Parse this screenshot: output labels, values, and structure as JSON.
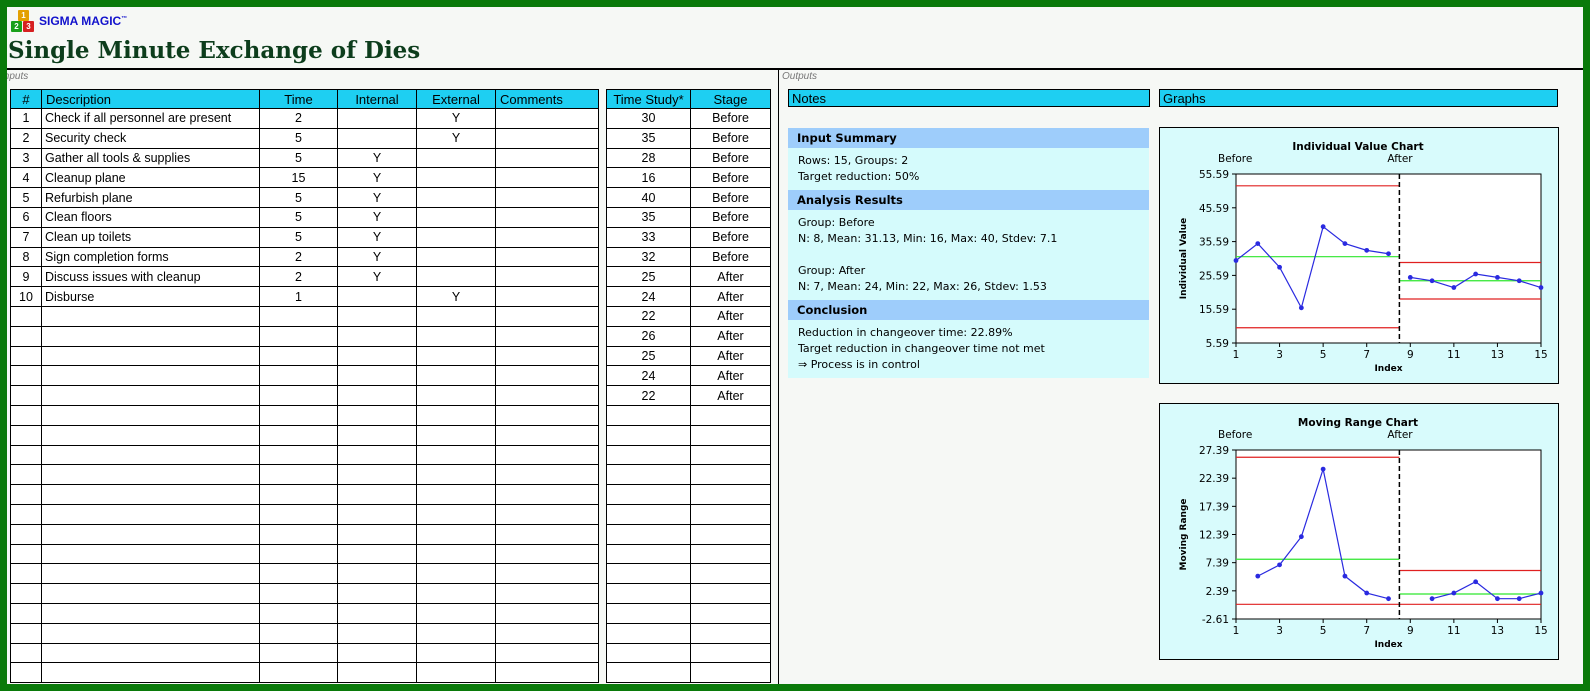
{
  "brand": {
    "name": "SIGMA MAGIC",
    "tm": "™"
  },
  "title": "Single Minute Exchange of Dies",
  "sections": {
    "inputs": "Inputs",
    "outputs": "Outputs"
  },
  "inputs": {
    "headers": [
      "#",
      "Description",
      "Time",
      "Internal",
      "External",
      "Comments"
    ],
    "rows": [
      {
        "n": "1",
        "desc": "Check if all personnel are present",
        "time": "2",
        "internal": "",
        "external": "Y",
        "comments": ""
      },
      {
        "n": "2",
        "desc": "Security check",
        "time": "5",
        "internal": "",
        "external": "Y",
        "comments": ""
      },
      {
        "n": "3",
        "desc": "Gather all tools & supplies",
        "time": "5",
        "internal": "Y",
        "external": "",
        "comments": ""
      },
      {
        "n": "4",
        "desc": "Cleanup plane",
        "time": "15",
        "internal": "Y",
        "external": "",
        "comments": ""
      },
      {
        "n": "5",
        "desc": "Refurbish plane",
        "time": "5",
        "internal": "Y",
        "external": "",
        "comments": ""
      },
      {
        "n": "6",
        "desc": "Clean floors",
        "time": "5",
        "internal": "Y",
        "external": "",
        "comments": ""
      },
      {
        "n": "7",
        "desc": "Clean up toilets",
        "time": "5",
        "internal": "Y",
        "external": "",
        "comments": ""
      },
      {
        "n": "8",
        "desc": "Sign completion forms",
        "time": "2",
        "internal": "Y",
        "external": "",
        "comments": ""
      },
      {
        "n": "9",
        "desc": "Discuss issues with cleanup",
        "time": "2",
        "internal": "Y",
        "external": "",
        "comments": ""
      },
      {
        "n": "10",
        "desc": "Disburse",
        "time": "1",
        "internal": "",
        "external": "Y",
        "comments": ""
      }
    ]
  },
  "time_study": {
    "headers": [
      "Time Study*",
      "Stage"
    ],
    "rows": [
      {
        "value": "30",
        "stage": "Before"
      },
      {
        "value": "35",
        "stage": "Before"
      },
      {
        "value": "28",
        "stage": "Before"
      },
      {
        "value": "16",
        "stage": "Before"
      },
      {
        "value": "40",
        "stage": "Before"
      },
      {
        "value": "35",
        "stage": "Before"
      },
      {
        "value": "33",
        "stage": "Before"
      },
      {
        "value": "32",
        "stage": "Before"
      },
      {
        "value": "25",
        "stage": "After"
      },
      {
        "value": "24",
        "stage": "After"
      },
      {
        "value": "22",
        "stage": "After"
      },
      {
        "value": "26",
        "stage": "After"
      },
      {
        "value": "25",
        "stage": "After"
      },
      {
        "value": "24",
        "stage": "After"
      },
      {
        "value": "22",
        "stage": "After"
      }
    ]
  },
  "outputs": {
    "notes_header": "Notes",
    "graphs_header": "Graphs",
    "notes": {
      "input_summary_title": "Input Summary",
      "input_summary_lines": [
        "Rows: 15, Groups: 2",
        "Target reduction: 50%"
      ],
      "analysis_title": "Analysis Results",
      "analysis_lines": [
        "Group: Before",
        "N: 8, Mean: 31.13, Min: 16, Max: 40, Stdev:  7.1",
        "",
        "Group: After",
        "N: 7, Mean: 24, Min: 22, Max: 26, Stdev:  1.53"
      ],
      "conclusion_title": "Conclusion",
      "conclusion_lines": [
        "Reduction in changeover time:  22.89%",
        "Target reduction in changeover time not met",
        "⇒ Process is in control"
      ]
    }
  },
  "colors": {
    "header_cyan": "#1ecff2",
    "note_header": "#9ecdfb",
    "note_body": "#d5fbfc",
    "chart_bg": "#d8fbfc",
    "series": "#2a2ae0",
    "center_line": "#2ee62e",
    "limit_line": "#e02020",
    "border_green": "#0a7a0a"
  },
  "chart_data": [
    {
      "type": "line",
      "title": "Individual  Value Chart",
      "xlabel": "Index",
      "ylabel": "Individual Value",
      "phase_labels": [
        "Before",
        "After"
      ],
      "x_ticks": [
        "1",
        "3",
        "5",
        "7",
        "9",
        "11",
        "13",
        "15"
      ],
      "y_ticks": [
        "5.59",
        "15.59",
        "25.59",
        "35.59",
        "45.59",
        "55.59"
      ],
      "ylim": [
        5.59,
        55.59
      ],
      "xlim": [
        1,
        15
      ],
      "split_x": 8.5,
      "series": [
        {
          "x": [
            1,
            2,
            3,
            4,
            5,
            6,
            7,
            8
          ],
          "values": [
            30,
            35,
            28,
            16,
            40,
            35,
            33,
            32
          ]
        },
        {
          "x": [
            9,
            10,
            11,
            12,
            13,
            14,
            15
          ],
          "values": [
            25,
            24,
            22,
            26,
            25,
            24,
            22
          ]
        }
      ],
      "center_lines": [
        31.13,
        24
      ],
      "ucl": [
        52.1,
        29.4
      ],
      "lcl": [
        10.1,
        18.6
      ],
      "grid": false
    },
    {
      "type": "line",
      "title": "Moving Range Chart",
      "xlabel": "Index",
      "ylabel": "Moving Range",
      "phase_labels": [
        "Before",
        "After"
      ],
      "x_ticks": [
        "1",
        "3",
        "5",
        "7",
        "9",
        "11",
        "13",
        "15"
      ],
      "y_ticks": [
        "-2.61",
        "2.39",
        "7.39",
        "12.39",
        "17.39",
        "22.39",
        "27.39"
      ],
      "ylim": [
        -2.61,
        27.39
      ],
      "xlim": [
        1,
        15
      ],
      "split_x": 8.5,
      "series": [
        {
          "x": [
            2,
            3,
            4,
            5,
            6,
            7,
            8
          ],
          "values": [
            5,
            7,
            12,
            24,
            5,
            2,
            1
          ]
        },
        {
          "x": [
            10,
            11,
            12,
            13,
            14,
            15
          ],
          "values": [
            1,
            2,
            4,
            1,
            1,
            2
          ]
        }
      ],
      "center_lines": [
        8,
        1.83
      ],
      "ucl": [
        26.1,
        6
      ],
      "lcl": [
        0,
        0
      ],
      "grid": false
    }
  ]
}
